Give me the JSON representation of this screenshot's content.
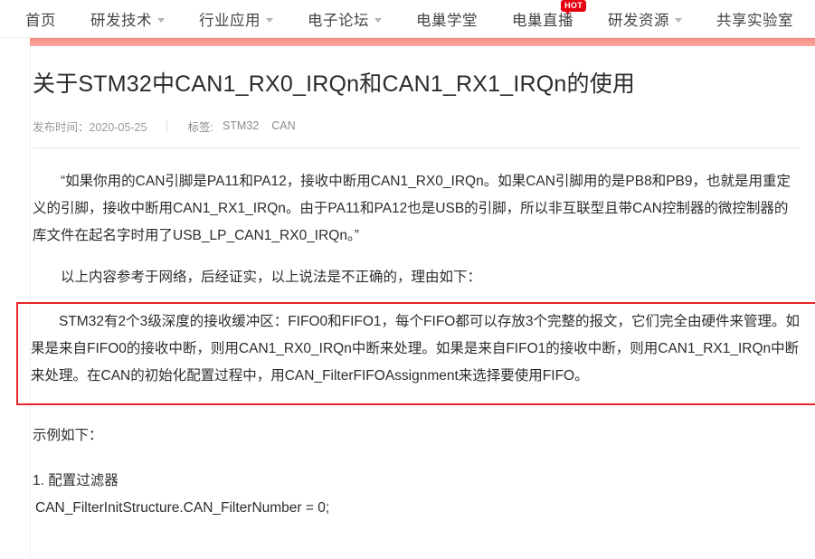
{
  "nav": {
    "items": [
      {
        "label": "首页",
        "has_caret": false,
        "badge": null
      },
      {
        "label": "研发技术",
        "has_caret": true,
        "badge": null
      },
      {
        "label": "行业应用",
        "has_caret": true,
        "badge": null
      },
      {
        "label": "电子论坛",
        "has_caret": true,
        "badge": null
      },
      {
        "label": "电巢学堂",
        "has_caret": false,
        "badge": null
      },
      {
        "label": "电巢直播",
        "has_caret": false,
        "badge": "HOT"
      },
      {
        "label": "研发资源",
        "has_caret": true,
        "badge": null
      },
      {
        "label": "共享实验室",
        "has_caret": false,
        "badge": null
      }
    ],
    "accent_color": "#f4897f",
    "badge_color": "#e60012"
  },
  "article": {
    "title": "关于STM32中CAN1_RX0_IRQn和CAN1_RX1_IRQn的使用",
    "meta": {
      "publish_label": "发布时间：2020-05-25",
      "tag_label": "标签:",
      "tags": [
        "STM32",
        "CAN"
      ]
    },
    "paragraphs": {
      "quote": "“如果你用的CAN引脚是PA11和PA12，接收中断用CAN1_RX0_IRQn。如果CAN引脚用的是PB8和PB9，也就是用重定义的引脚，接收中断用CAN1_RX1_IRQn。由于PA11和PA12也是USB的引脚，所以非互联型且带CAN控制器的微控制器的库文件在起名字时用了USB_LP_CAN1_RX0_IRQn。”",
      "note": "以上内容参考于网络，后经证实，以上说法是不正确的，理由如下：",
      "highlighted": "STM32有2个3级深度的接收缓冲区：FIFO0和FIFO1，每个FIFO都可以存放3个完整的报文，它们完全由硬件来管理。如果是来自FIFO0的接收中断，则用CAN1_RX0_IRQn中断来处理。如果是来自FIFO1的接收中断，则用CAN1_RX1_IRQn中断来处理。在CAN的初始化配置过程中，用CAN_FilterFIFOAssignment来选择要使用FIFO。",
      "sample_intro": "示例如下：",
      "step_one": "1. 配置过滤器",
      "code_line_one": "CAN_FilterInitStructure.CAN_FilterNumber = 0;"
    },
    "highlight_border_color": "#e8252a"
  }
}
